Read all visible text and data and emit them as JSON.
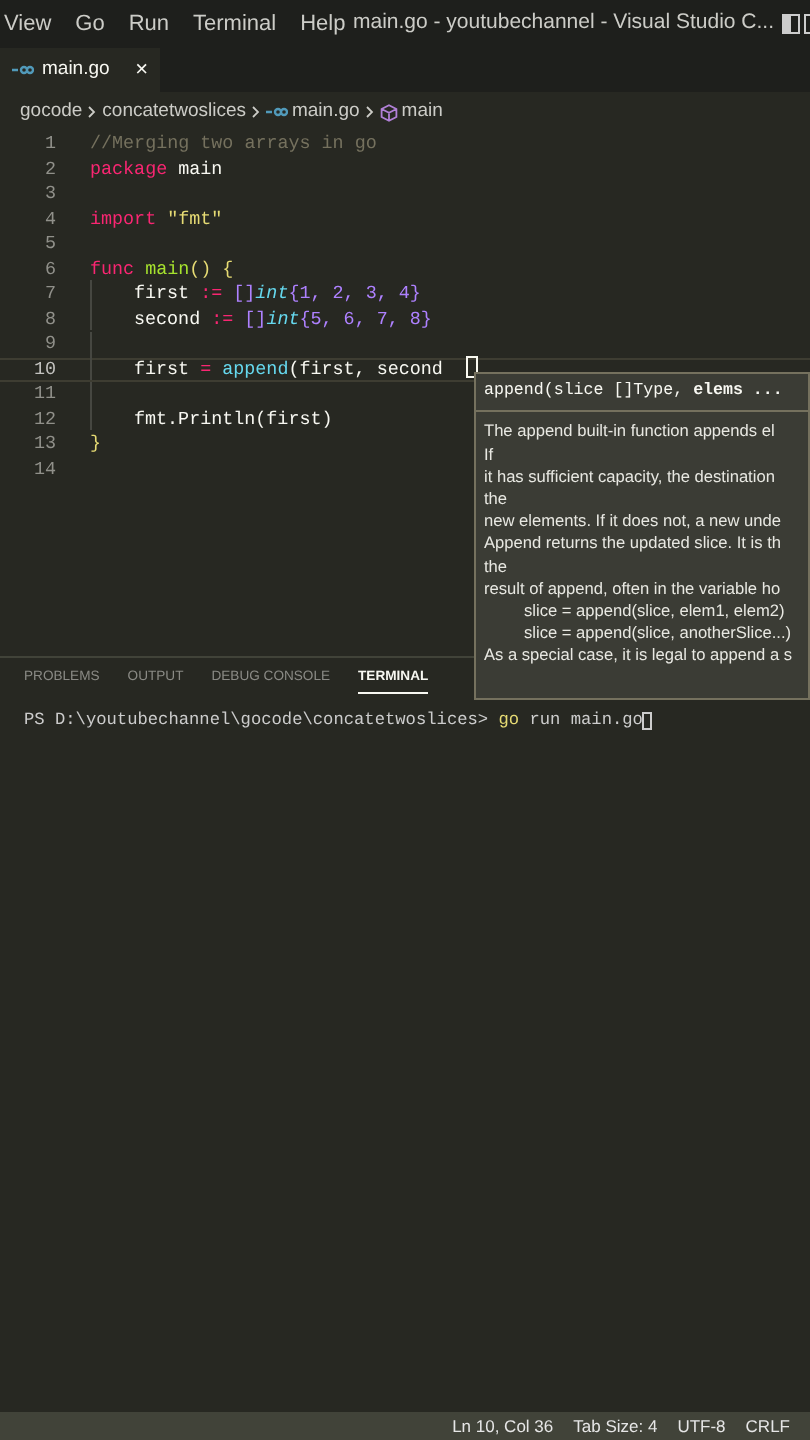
{
  "menu": [
    "View",
    "Go",
    "Run",
    "Terminal",
    "Help"
  ],
  "window": {
    "title": "main.go - youtubechannel - Visual Studio C..."
  },
  "tabs": [
    {
      "label": "main.go",
      "selected": true,
      "close": "×"
    }
  ],
  "breadcrumbs": [
    {
      "kind": "folder",
      "label": "gocode"
    },
    {
      "kind": "folder",
      "label": "concatetwoslices"
    },
    {
      "kind": "file",
      "label": "main.go"
    },
    {
      "kind": "symbol",
      "label": "main"
    }
  ],
  "editor": {
    "lines": [
      {
        "number": "1",
        "current": false,
        "indent": false,
        "tokens": [
          {
            "kind": "comment",
            "text": "//Merging two arrays in go"
          }
        ]
      },
      {
        "number": "2",
        "current": false,
        "indent": false,
        "tokens": [
          {
            "kind": "keyword",
            "text": "package "
          },
          {
            "kind": "plain",
            "text": "main"
          }
        ]
      },
      {
        "number": "3",
        "current": false,
        "indent": false
      },
      {
        "number": "4",
        "current": false,
        "indent": false,
        "tokens": [
          {
            "kind": "keyword",
            "text": "import "
          },
          {
            "kind": "string",
            "text": "\"fmt\""
          }
        ]
      },
      {
        "number": "5",
        "current": false,
        "indent": false
      },
      {
        "number": "6",
        "current": false,
        "indent": false,
        "tokens": [
          {
            "kind": "keyword",
            "text": "func "
          },
          {
            "kind": "func",
            "text": "main"
          },
          {
            "kind": "brace",
            "text": "() {"
          }
        ]
      },
      {
        "number": "7",
        "current": false,
        "indent": true,
        "tokens": [
          {
            "kind": "plain",
            "text": "first "
          },
          {
            "kind": "keyword",
            "text": ":= "
          },
          {
            "kind": "punct",
            "text": "[]"
          },
          {
            "kind": "type",
            "text": "int"
          },
          {
            "kind": "punct",
            "text": "{"
          },
          {
            "kind": "number",
            "text": "1"
          },
          {
            "kind": "punct",
            "text": ", "
          },
          {
            "kind": "number",
            "text": "2"
          },
          {
            "kind": "punct",
            "text": ", "
          },
          {
            "kind": "number",
            "text": "3"
          },
          {
            "kind": "punct",
            "text": ", "
          },
          {
            "kind": "number",
            "text": "4"
          },
          {
            "kind": "punct",
            "text": "}"
          }
        ]
      },
      {
        "number": "8",
        "current": false,
        "indent": true,
        "tokens": [
          {
            "kind": "plain",
            "text": "second "
          },
          {
            "kind": "keyword",
            "text": ":= "
          },
          {
            "kind": "punct",
            "text": "[]"
          },
          {
            "kind": "type",
            "text": "int"
          },
          {
            "kind": "punct",
            "text": "{"
          },
          {
            "kind": "number",
            "text": "5"
          },
          {
            "kind": "punct",
            "text": ", "
          },
          {
            "kind": "number",
            "text": "6"
          },
          {
            "kind": "punct",
            "text": ", "
          },
          {
            "kind": "number",
            "text": "7"
          },
          {
            "kind": "punct",
            "text": ", "
          },
          {
            "kind": "number",
            "text": "8"
          },
          {
            "kind": "punct",
            "text": "}"
          }
        ]
      },
      {
        "number": "9",
        "current": false,
        "indent": true
      },
      {
        "number": "10",
        "current": true,
        "indent": true,
        "tokens": [
          {
            "kind": "plain",
            "text": "first "
          },
          {
            "kind": "keyword",
            "text": "= "
          },
          {
            "kind": "builtin",
            "text": "append"
          },
          {
            "kind": "plain",
            "text": "(first, second"
          }
        ]
      },
      {
        "number": "11",
        "current": false,
        "indent": true
      },
      {
        "number": "12",
        "current": false,
        "indent": true,
        "tokens": [
          {
            "kind": "plain",
            "text": "fmt.Println(first)"
          }
        ]
      },
      {
        "number": "13",
        "current": false,
        "indent": false,
        "tokens": [
          {
            "kind": "brace",
            "text": "}"
          }
        ]
      },
      {
        "number": "14",
        "current": false,
        "indent": false
      }
    ]
  },
  "hover": {
    "signature": "append(slice []Type, **elems ...**",
    "lines": [
      {
        "kind": "text",
        "text": "The append built-in function appends el"
      },
      {
        "kind": "text",
        "text": "If"
      },
      {
        "kind": "text",
        "text": "it has sufficient capacity, the destination"
      },
      {
        "kind": "text",
        "text": "the"
      },
      {
        "kind": "text",
        "text": "new elements. If it does not, a new unde"
      },
      {
        "kind": "text",
        "text": "Append returns the updated slice. It is th"
      },
      {
        "kind": "text",
        "text": "the"
      },
      {
        "kind": "text",
        "text": "result of append, often in the variable ho"
      },
      {
        "kind": "example",
        "text": "slice = append(slice, elem1, elem2)"
      },
      {
        "kind": "example",
        "text": "slice = append(slice, anotherSlice...)"
      },
      {
        "kind": "text",
        "text": "As a special case, it is legal to append a s"
      }
    ]
  },
  "panel": {
    "tabs": [
      {
        "label": "PROBLEMS",
        "selected": false
      },
      {
        "label": "OUTPUT",
        "selected": false
      },
      {
        "label": "DEBUG CONSOLE",
        "selected": false
      },
      {
        "label": "TERMINAL",
        "selected": true
      }
    ],
    "terminal": {
      "prompt": "PS D:\\youtubechannel\\gocode\\concatetwoslices>",
      "command": "go",
      "args": "run main.go"
    }
  },
  "status_bar": [
    "Ln 10, Col 36",
    "Tab Size: 4",
    "UTF-8",
    "CRLF"
  ]
}
